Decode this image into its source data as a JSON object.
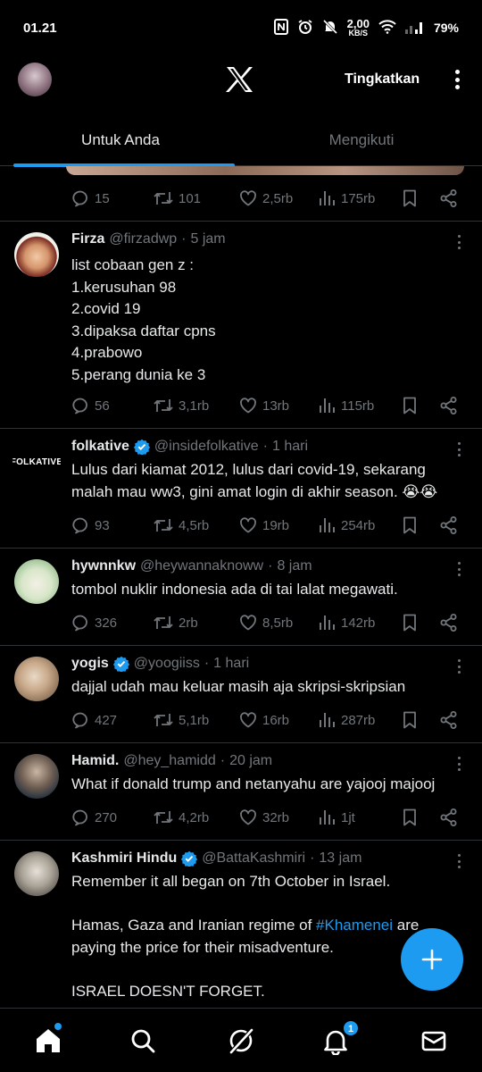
{
  "status_bar": {
    "time": "01.21",
    "net_speed_value": "2,00",
    "net_speed_unit": "KB/S",
    "battery": "79%"
  },
  "header": {
    "upgrade_label": "Tingkatkan"
  },
  "tabs": [
    {
      "label": "Untuk Anda",
      "active": true
    },
    {
      "label": "Mengikuti",
      "active": false
    }
  ],
  "top_post": {
    "replies": "15",
    "reposts": "101",
    "likes": "2,5rb",
    "views": "175rb"
  },
  "tweets": [
    {
      "name": "Firza",
      "handle": "@firzadwp",
      "time": "5 jam",
      "verified": false,
      "lines": [
        "list cobaan gen z :",
        "1.kerusuhan 98",
        "2.covid 19",
        "3.dipaksa daftar cpns",
        "4.prabowo",
        "5.perang dunia ke 3"
      ],
      "replies": "56",
      "reposts": "3,1rb",
      "likes": "13rb",
      "views": "115rb"
    },
    {
      "name": "folkative",
      "handle": "@insidefolkative",
      "time": "1 hari",
      "verified": true,
      "avatar_text": "FOLKATIVE",
      "lines": [
        "Lulus dari kiamat 2012, lulus dari covid-19, sekarang",
        "malah mau ww3, gini amat login di akhir season. 😭😭"
      ],
      "replies": "93",
      "reposts": "4,5rb",
      "likes": "19rb",
      "views": "254rb"
    },
    {
      "name": "hywnnkw",
      "handle": "@heywannaknoww",
      "time": "8 jam",
      "verified": false,
      "lines": [
        "tombol nuklir indonesia ada di tai lalat megawati."
      ],
      "replies": "326",
      "reposts": "2rb",
      "likes": "8,5rb",
      "views": "142rb"
    },
    {
      "name": "yogis",
      "handle": "@yoogiiss",
      "time": "1 hari",
      "verified": true,
      "lines": [
        "dajjal udah mau keluar masih aja skripsi-skripsian"
      ],
      "replies": "427",
      "reposts": "5,1rb",
      "likes": "16rb",
      "views": "287rb"
    },
    {
      "name": "Hamid.",
      "handle": "@hey_hamidd",
      "time": "20 jam",
      "verified": false,
      "lines": [
        "What if donald trump and netanyahu are yajooj majooj"
      ],
      "replies": "270",
      "reposts": "4,2rb",
      "likes": "32rb",
      "views": "1jt"
    },
    {
      "name": "Kashmiri Hindu",
      "handle": "@BattaKashmiri",
      "time": "13 jam",
      "verified": true,
      "line1": "Remember it all began on 7th October in Israel.",
      "line2_prefix": "Hamas, Gaza and Iranian regime of ",
      "line2_hashtag": "#Khamenei",
      "line2_suffix": " are",
      "line3": "paying the price for their misadventure.",
      "line4": "ISRAEL DOESN'T FORGET."
    }
  ],
  "bottom_nav": {
    "notifications_badge": "1"
  },
  "colors": {
    "accent": "#1d9bf0",
    "muted": "#71767b",
    "text": "#e7e9ea",
    "divider": "#2f3336"
  }
}
